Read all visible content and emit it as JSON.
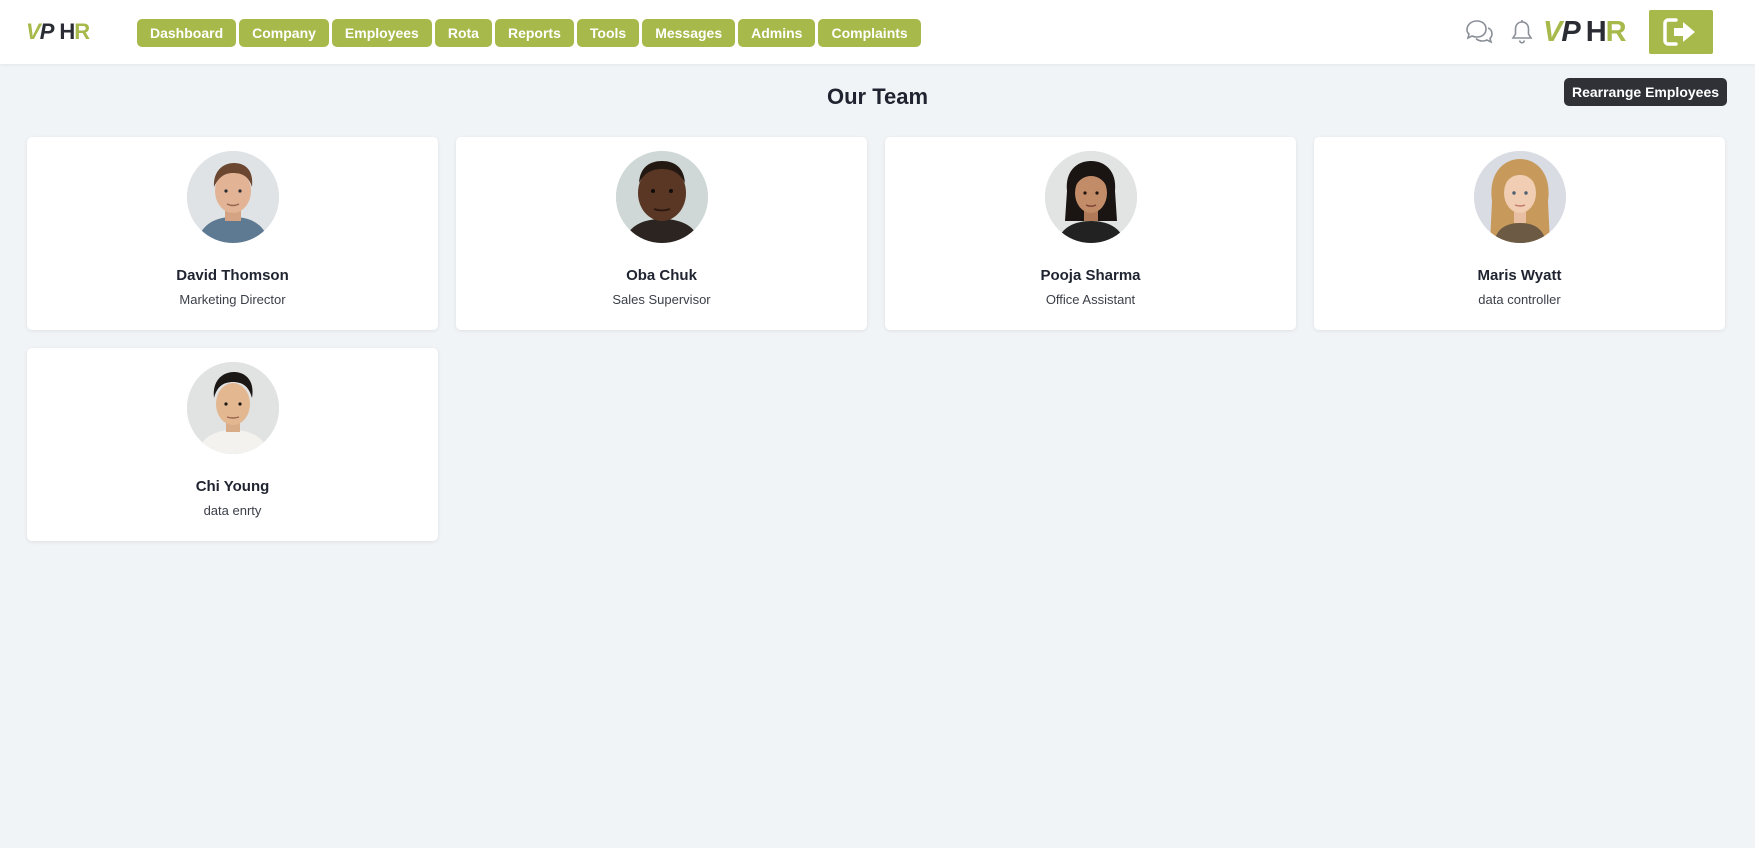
{
  "header": {
    "logo_left": {
      "part1": "V",
      "part2": "P",
      "part3": "H",
      "part4": "R"
    },
    "logo_right": {
      "part1": "V",
      "part2": "P",
      "part3": "H",
      "part4": "R"
    },
    "nav": [
      {
        "label": "Dashboard"
      },
      {
        "label": "Company"
      },
      {
        "label": "Employees"
      },
      {
        "label": "Rota"
      },
      {
        "label": "Reports"
      },
      {
        "label": "Tools"
      },
      {
        "label": "Messages"
      },
      {
        "label": "Admins"
      },
      {
        "label": "Complaints"
      }
    ],
    "icons": {
      "chat": "chat-bubbles-icon",
      "bell": "bell-icon",
      "logout": "logout-icon"
    }
  },
  "main": {
    "title": "Our Team",
    "rearrange_label": "Rearrange Employees",
    "employees": [
      {
        "name": "David Thomson",
        "role": "Marketing Director"
      },
      {
        "name": "Oba Chuk",
        "role": "Sales Supervisor"
      },
      {
        "name": "Pooja Sharma",
        "role": "Office Assistant"
      },
      {
        "name": "Maris Wyatt",
        "role": "data controller"
      },
      {
        "name": "Chi Young",
        "role": "data enrty"
      }
    ]
  },
  "colors": {
    "accent": "#a7b94a",
    "dark": "#2f3136",
    "background": "#f1f4f7"
  }
}
